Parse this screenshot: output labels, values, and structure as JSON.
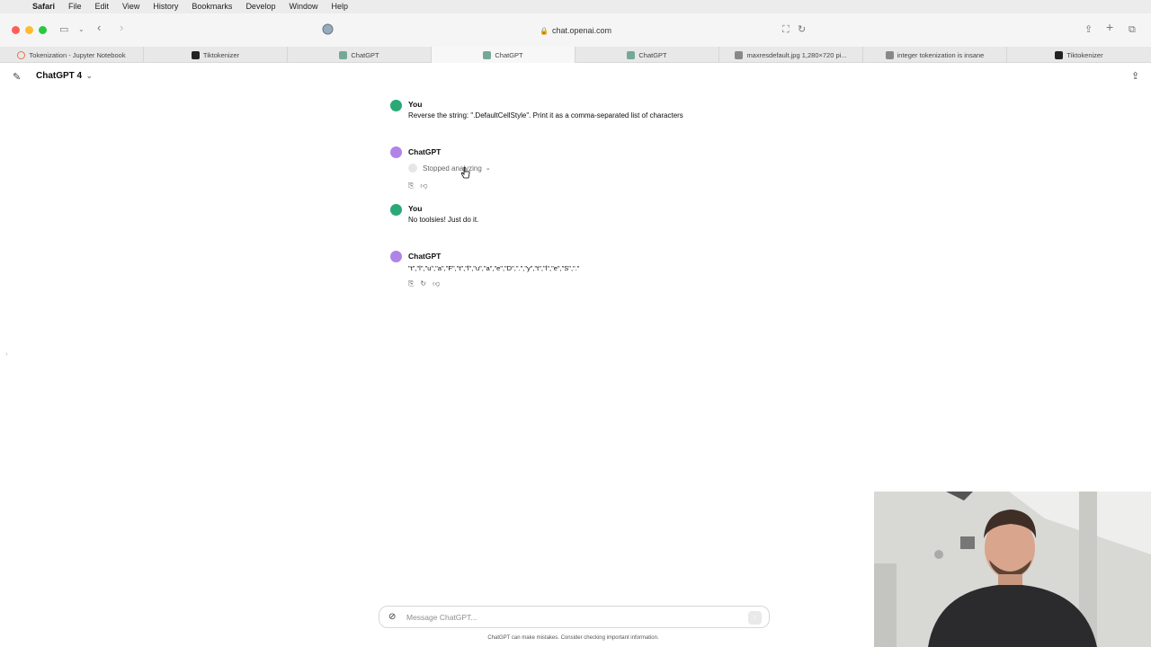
{
  "menubar": {
    "items": [
      "Safari",
      "File",
      "Edit",
      "View",
      "History",
      "Bookmarks",
      "Develop",
      "Window",
      "Help"
    ]
  },
  "toolbar": {
    "url": "chat.openai.com"
  },
  "tabs": [
    {
      "label": "Tokenization - Jupyter Notebook",
      "active": false,
      "color": "#e8734a"
    },
    {
      "label": "Tiktokenizer",
      "active": false,
      "color": "#222222"
    },
    {
      "label": "ChatGPT",
      "active": false,
      "color": "#76a89a"
    },
    {
      "label": "ChatGPT",
      "active": true,
      "color": "#76a89a"
    },
    {
      "label": "ChatGPT",
      "active": false,
      "color": "#76a89a"
    },
    {
      "label": "maxresdefault.jpg 1,280×720 pi...",
      "active": false,
      "color": "#888888"
    },
    {
      "label": "integer tokenization is insane",
      "active": false,
      "color": "#888888"
    },
    {
      "label": "Tiktokenizer",
      "active": false,
      "color": "#222222"
    }
  ],
  "header": {
    "model": "ChatGPT 4"
  },
  "conversation": [
    {
      "author": "You",
      "text": "Reverse the string: \".DefaultCellStyle\". Print it as a comma-separated list of characters"
    },
    {
      "author": "ChatGPT",
      "status": "Stopped analyzing"
    },
    {
      "author": "You",
      "text": "No toolsies! Just do it."
    },
    {
      "author": "ChatGPT",
      "text": "\"t\",\"l\",\"u\",\"a\",\"F\",\"t\",\"l\",\"u\",\"a\",\"e\",\"D\",\".\",\"y\",\"t\",\"l\",\"e\",\"S\",\".\""
    }
  ],
  "composer": {
    "placeholder": "Message ChatGPT..."
  },
  "disclaimer": "ChatGPT can make mistakes. Consider checking important information.",
  "colors": {
    "user_avatar": "#2aa876",
    "bot_avatar": "#b084e6"
  }
}
